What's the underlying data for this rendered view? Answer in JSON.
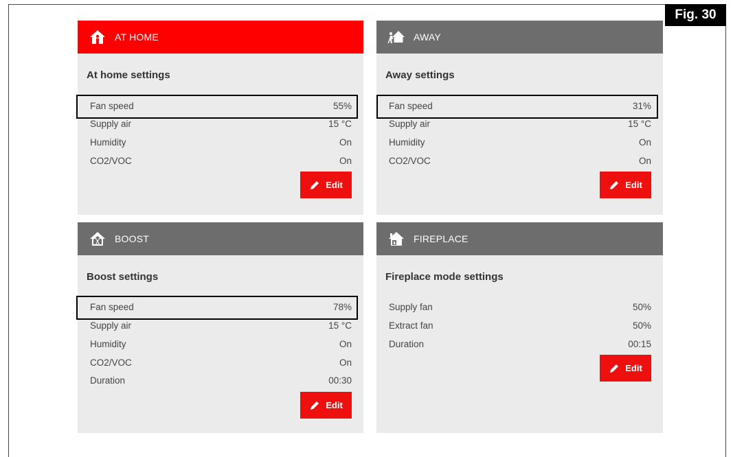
{
  "figure_label": "Fig. 30",
  "cards": {
    "at_home": {
      "title": "AT HOME",
      "subtitle": "At home settings",
      "icon": "home-person-icon",
      "rows": [
        {
          "label": "Fan speed",
          "value": "55%"
        },
        {
          "label": "Supply air",
          "value": "15 °C"
        },
        {
          "label": "Humidity",
          "value": "On"
        },
        {
          "label": "CO2/VOC",
          "value": "On"
        }
      ],
      "edit_label": "Edit"
    },
    "away": {
      "title": "AWAY",
      "subtitle": "Away settings",
      "icon": "away-person-house-icon",
      "rows": [
        {
          "label": "Fan speed",
          "value": "31%"
        },
        {
          "label": "Supply air",
          "value": "15 °C"
        },
        {
          "label": "Humidity",
          "value": "On"
        },
        {
          "label": "CO2/VOC",
          "value": "On"
        }
      ],
      "edit_label": "Edit"
    },
    "boost": {
      "title": "BOOST",
      "subtitle": "Boost settings",
      "icon": "boost-fan-house-icon",
      "rows": [
        {
          "label": "Fan speed",
          "value": "78%"
        },
        {
          "label": "Supply air",
          "value": "15 °C"
        },
        {
          "label": "Humidity",
          "value": "On"
        },
        {
          "label": "CO2/VOC",
          "value": "On"
        },
        {
          "label": "Duration",
          "value": "00:30"
        }
      ],
      "edit_label": "Edit"
    },
    "fireplace": {
      "title": "FIREPLACE",
      "subtitle": "Fireplace mode settings",
      "icon": "fireplace-house-icon",
      "rows": [
        {
          "label": "Supply fan",
          "value": "50%"
        },
        {
          "label": "Extract fan",
          "value": "50%"
        },
        {
          "label": "Duration",
          "value": "00:15"
        }
      ],
      "edit_label": "Edit"
    }
  },
  "colors": {
    "active_header": "#ff0000",
    "inactive_header": "#6d6d6d",
    "card_background": "#ebebeb",
    "edit_button": "#ee0f0f"
  }
}
